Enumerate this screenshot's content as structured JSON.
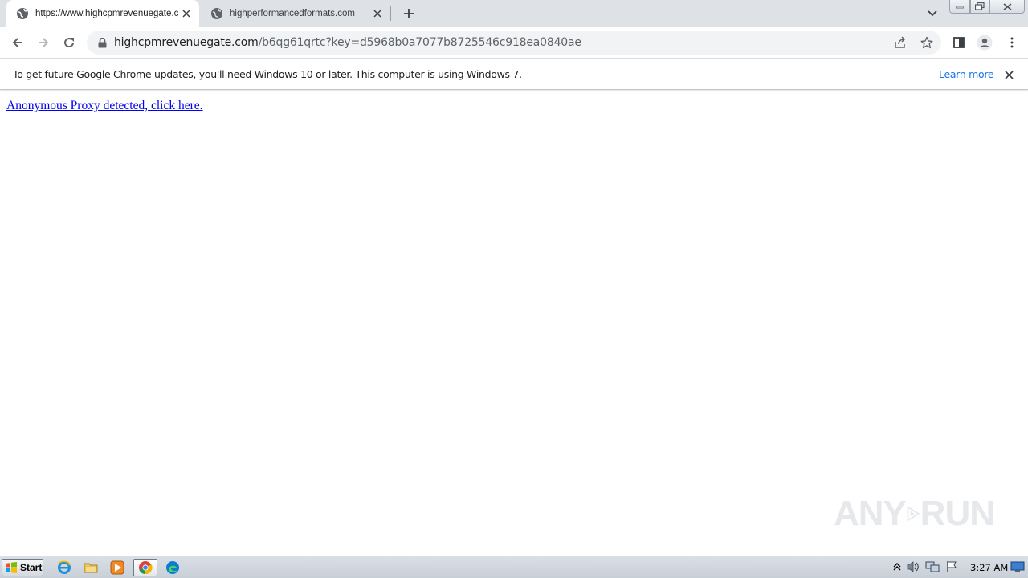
{
  "browser": {
    "tabs": [
      {
        "title": "https://www.highcpmrevenuegate.c",
        "favicon": "globe-icon",
        "active": true
      },
      {
        "title": "highperformancedformats.com",
        "favicon": "globe-icon",
        "active": false
      }
    ],
    "omnibox": {
      "host": "highcpmrevenuegate.com",
      "path": "/b6qg61qrtc?key=d5968b0a7077b8725546c918ea0840ae"
    },
    "infobar": {
      "message": "To get future Google Chrome updates, you'll need Windows 10 or later. This computer is using Windows 7.",
      "link": "Learn more"
    }
  },
  "page": {
    "link_text": "Anonymous Proxy detected, click here."
  },
  "watermark": {
    "text_left": "ANY",
    "text_right": "RUN"
  },
  "taskbar": {
    "start_label": "Start",
    "clock": "3:27 AM",
    "pinned": [
      "internet-explorer-icon",
      "folder-icon",
      "media-player-icon",
      "chrome-icon",
      "edge-icon"
    ]
  }
}
